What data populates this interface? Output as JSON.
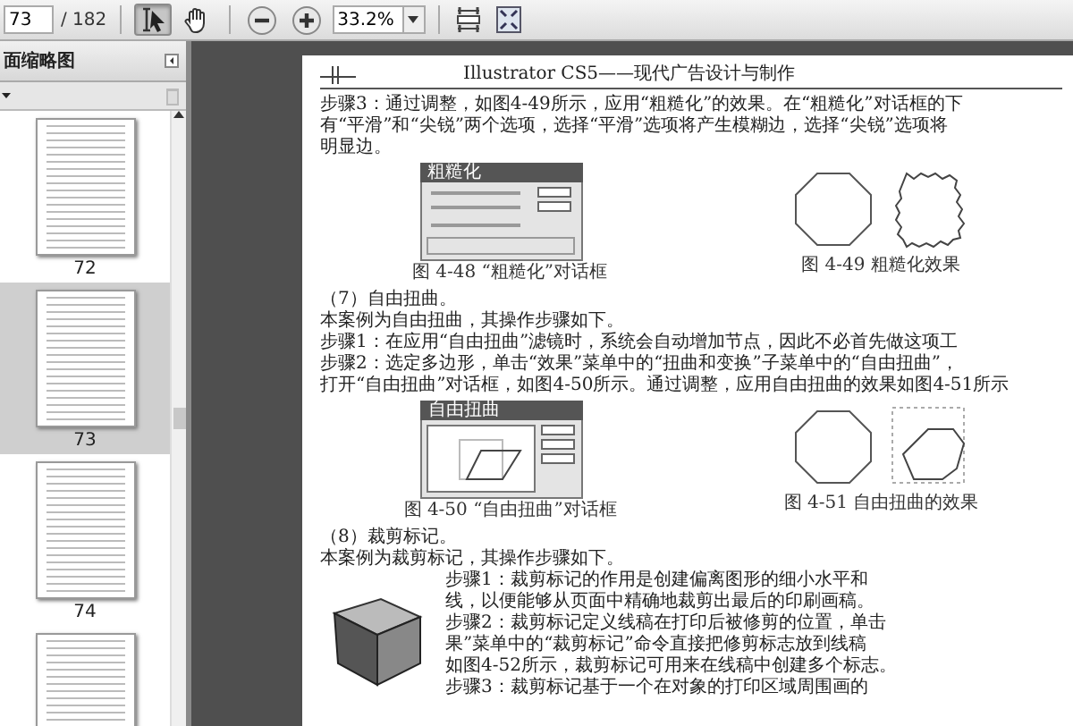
{
  "toolbar": {
    "page": "73",
    "page_count": "/ 182",
    "tools": [
      {
        "kind": "select",
        "selected": true
      },
      {
        "kind": "hand",
        "selected": false
      }
    ],
    "zoom": "33.2%"
  },
  "sidebar": {
    "title": "面缩略图",
    "thumbnails": [
      {
        "label": "72",
        "selected": false
      },
      {
        "label": "73",
        "selected": true
      },
      {
        "label": "74",
        "selected": false
      },
      {
        "selected": false
      }
    ]
  },
  "document": {
    "header": "Illustrator CS5——现代广告设计与制作",
    "blocks": [
      {
        "kind": "para",
        "lines": [
          "步骤3：通过调整，如图4-49所示，应用“粗糙化”的效果。在“粗糙化”对话框的下",
          "有“平滑”和“尖锐”两个选项，选择“平滑”选项将产生模糊边，选择“尖锐”选项将",
          "明显边。"
        ]
      },
      {
        "kind": "figures",
        "items": [
          {
            "kind": "roughen-dialog",
            "title": "粗糙化",
            "caption": "图 4-48 “粗糙化”对话框"
          },
          {
            "kind": "roughen-shapes",
            "caption": "图 4-49 粗糙化效果"
          }
        ]
      },
      {
        "kind": "para",
        "lines": [
          "（7）自由扭曲。",
          "本案例为自由扭曲，其操作步骤如下。",
          "步骤1：在应用“自由扭曲”滤镜时，系统会自动增加节点，因此不必首先做这项工",
          "步骤2：选定多边形，单击“效果”菜单中的“扭曲和变换”子菜单中的“自由扭曲”，",
          "打开“自由扭曲”对话框，如图4-50所示。通过调整，应用自由扭曲的效果如图4-51所示"
        ]
      },
      {
        "kind": "figures",
        "items": [
          {
            "kind": "distort-dialog",
            "title": "自由扭曲",
            "caption": "图 4-50 “自由扭曲”对话框"
          },
          {
            "kind": "distort-shapes",
            "caption": "图 4-51 自由扭曲的效果"
          }
        ]
      },
      {
        "kind": "para",
        "lines": [
          "（8）裁剪标记。",
          "本案例为裁剪标记，其操作步骤如下。"
        ]
      },
      {
        "kind": "cube",
        "lines": [
          "步骤1：裁剪标记的作用是创建偏离图形的细小水平和",
          "线，以便能够从页面中精确地裁剪出最后的印刷画稿。",
          "步骤2：裁剪标记定义线稿在打印后被修剪的位置，单击",
          "果”菜单中的“裁剪标记”命令直接把修剪标志放到线稿",
          "如图4-52所示，裁剪标记可用来在线稿中创建多个标志。",
          "步骤3：裁剪标记基于一个在对象的打印区域周围画的"
        ]
      }
    ]
  }
}
